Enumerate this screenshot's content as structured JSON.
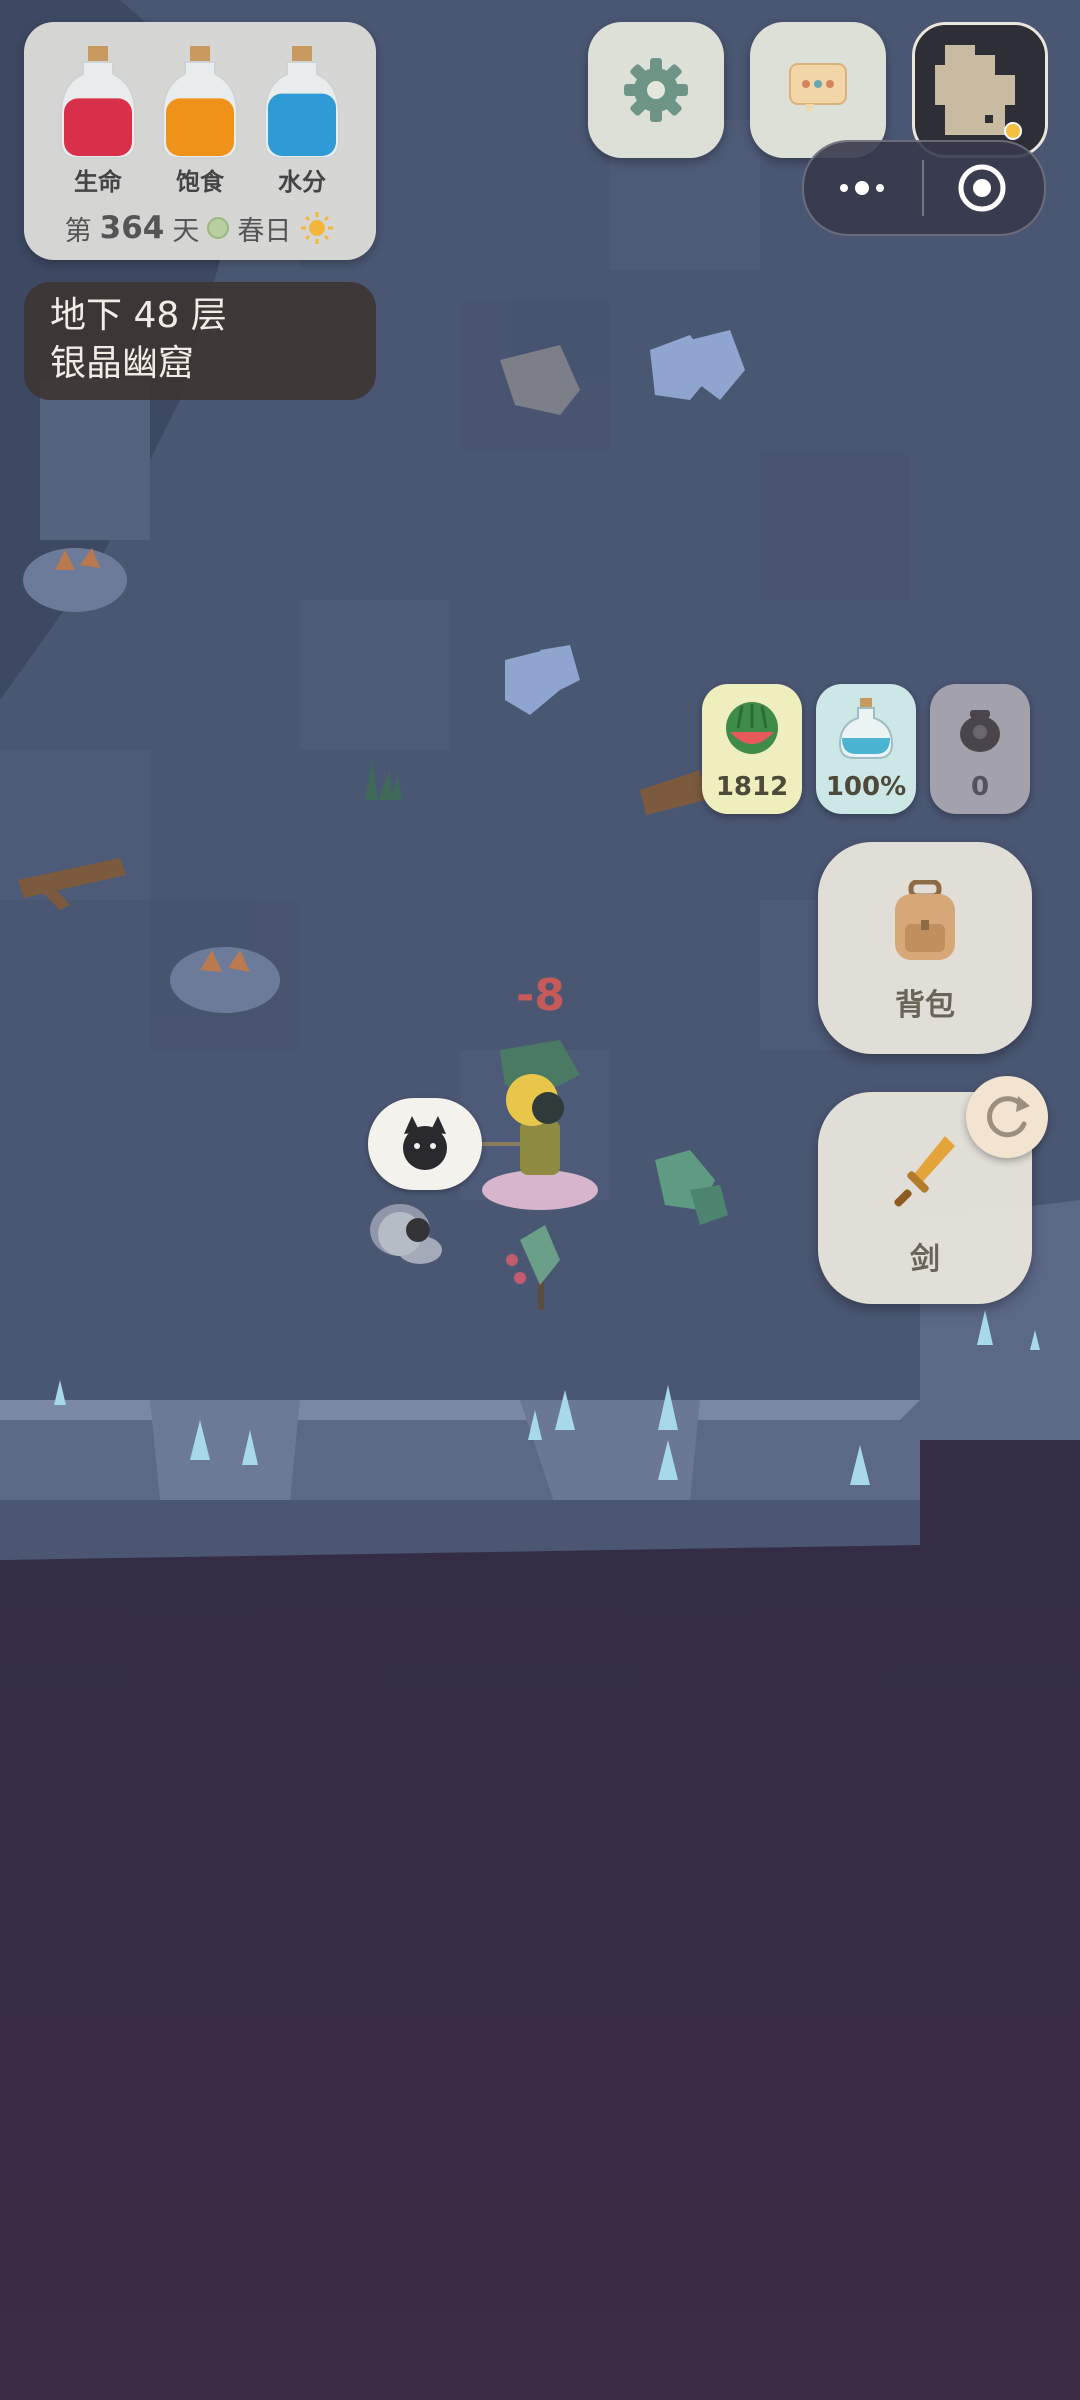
{
  "status": {
    "bars": [
      {
        "label": "生命",
        "fill": 0.72,
        "color": "#d8304a"
      },
      {
        "label": "饱食",
        "fill": 0.72,
        "color": "#f0921a"
      },
      {
        "label": "水分",
        "fill": 0.78,
        "color": "#2e9ad6"
      }
    ],
    "day_prefix": "第",
    "day_number": "364",
    "day_suffix": "天",
    "season": "春日",
    "weather_icon": "sun-icon"
  },
  "location": {
    "floor": "地下 48 层",
    "name": "银晶幽窟"
  },
  "top_buttons": {
    "settings_icon": "gear-icon",
    "chat_icon": "chat-bubble-icon",
    "minimap_icon": "minimap"
  },
  "resources": [
    {
      "icon": "watermelon-icon",
      "value": "1812",
      "bg": "#efeebd"
    },
    {
      "icon": "water-bottle-icon",
      "value": "100%",
      "bg": "#cde6e6"
    },
    {
      "icon": "pot-icon",
      "value": "0",
      "bg": "#a3a1ab"
    }
  ],
  "actions": {
    "backpack_label": "背包",
    "weapon_label": "剑",
    "swap_icon": "refresh-icon"
  },
  "combat": {
    "damage_text": "-8",
    "enemy_icon": "black-cat-icon"
  }
}
